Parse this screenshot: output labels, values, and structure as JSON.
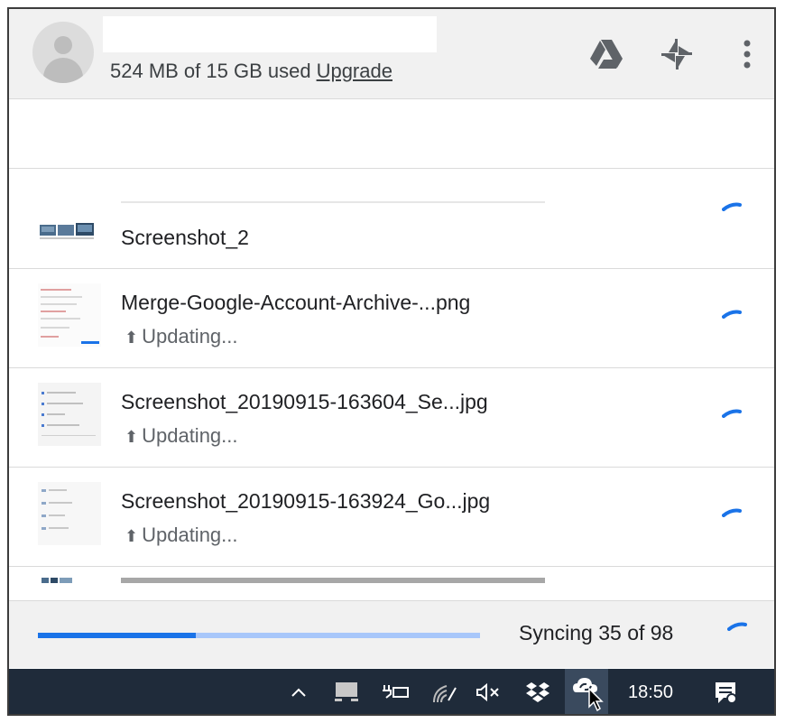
{
  "header": {
    "usage_text": "524 MB of 15 GB used",
    "upgrade_label": "Upgrade",
    "icons": [
      "drive-icon",
      "pin-icon",
      "more-vert-icon"
    ]
  },
  "files": [
    {
      "name": "Screenshot_2",
      "status": ""
    },
    {
      "name": "Merge-Google-Account-Archive-...png",
      "status": "Updating..."
    },
    {
      "name": "Screenshot_20190915-163604_Se...jpg",
      "status": "Updating..."
    },
    {
      "name": "Screenshot_20190915-163924_Go...jpg",
      "status": "Updating..."
    }
  ],
  "footer": {
    "sync_text": "Syncing 35 of 98",
    "progress": 0.357
  },
  "taskbar": {
    "clock": "18:50",
    "icons": [
      "chevron-up-icon",
      "tablet-icon",
      "battery-icon",
      "wifi-icon",
      "volume-muted-icon",
      "dropbox-icon",
      "backup-sync-icon",
      "notifications-icon"
    ]
  },
  "colors": {
    "accent": "#1a73e8",
    "accent_light": "#a8c7fa",
    "taskbar": "#1f2b3a"
  }
}
